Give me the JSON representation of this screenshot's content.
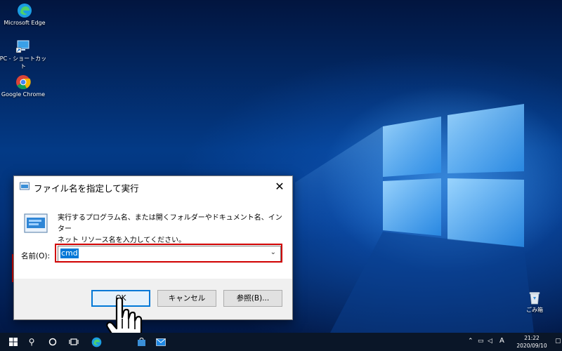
{
  "desktop": {
    "icons": [
      {
        "label": "Microsoft Edge"
      },
      {
        "label": "PC - ショートカット"
      },
      {
        "label": "Google Chrome"
      },
      {
        "label": "ごみ箱"
      }
    ]
  },
  "run_dialog": {
    "title": "ファイル名を指定して実行",
    "description_line1": "実行するプログラム名、または開くフォルダーやドキュメント名、インター",
    "description_line2": "ネット リソース名を入力してください。",
    "name_label": "名前(O):",
    "name_value": "cmd",
    "buttons": {
      "ok": "OK",
      "cancel": "キャンセル",
      "browse": "参照(B)..."
    }
  },
  "taskbar": {
    "ime_mode": "A",
    "time": "21:22",
    "date": "2020/09/10"
  },
  "colors": {
    "accent": "#0078d7",
    "highlight_box": "#d00000",
    "taskbar": "#0a1628"
  }
}
